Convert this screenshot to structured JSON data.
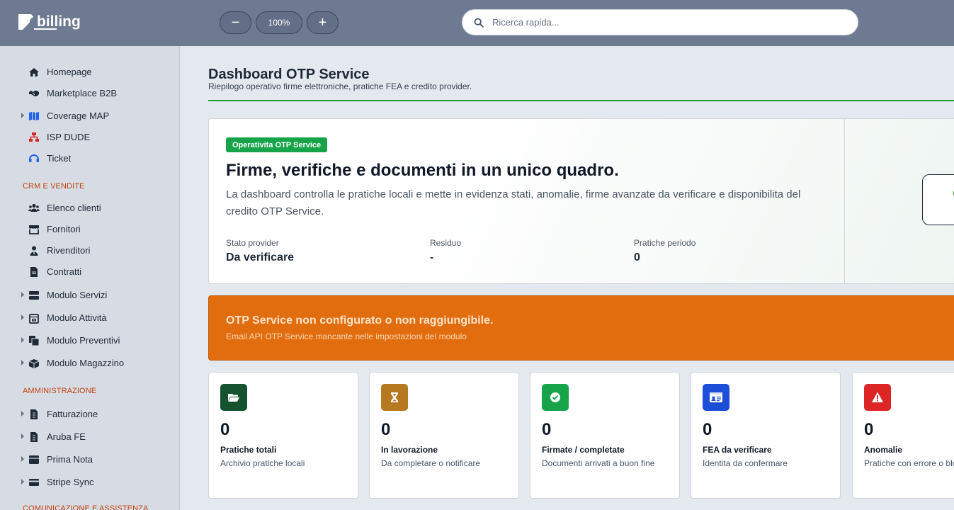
{
  "app": {
    "logo_text": "billing"
  },
  "toolbar": {
    "zoom_out_label": "−",
    "zoom_level": "100%",
    "zoom_in_label": "+"
  },
  "search": {
    "placeholder": "Ricerca rapida..."
  },
  "sidebar": {
    "items": [
      {
        "label": "Homepage",
        "icon": "home-icon"
      },
      {
        "label": "Marketplace B2B",
        "icon": "handshake-icon"
      },
      {
        "label": "Coverage MAP",
        "icon": "map-icon",
        "accent": "#2563eb"
      },
      {
        "label": "ISP DUDE",
        "icon": "network-icon",
        "accent": "#dc2626"
      },
      {
        "label": "Ticket",
        "icon": "headset-icon",
        "accent": "#2563eb"
      }
    ],
    "sections": [
      {
        "title": "CRM E VENDITE",
        "items": [
          {
            "label": "Elenco clienti",
            "icon": "users-icon"
          },
          {
            "label": "Fornitori",
            "icon": "store-icon"
          },
          {
            "label": "Rivenditori",
            "icon": "user-tie-icon"
          },
          {
            "label": "Contratti",
            "icon": "document-icon"
          },
          {
            "label": "Modulo Servizi",
            "icon": "server-icon"
          },
          {
            "label": "Modulo Attività",
            "icon": "calendar-icon"
          },
          {
            "label": "Modulo Preventivi",
            "icon": "file-copy-icon"
          },
          {
            "label": "Modulo Magazzino",
            "icon": "boxes-icon"
          }
        ]
      },
      {
        "title": "AMMINISTRAZIONE",
        "items": [
          {
            "label": "Fatturazione",
            "icon": "invoice-icon"
          },
          {
            "label": "Aruba FE",
            "icon": "invoice-icon"
          },
          {
            "label": "Prima Nota",
            "icon": "ledger-icon"
          },
          {
            "label": "Stripe Sync",
            "icon": "credit-card-icon"
          }
        ]
      },
      {
        "title": "COMUNICAZIONE E ASSISTENZA",
        "items": []
      }
    ]
  },
  "page": {
    "title": "Dashboard OTP Service",
    "subtitle": "Riepilogo operativo firme elettroniche, pratiche FEA e credito provider."
  },
  "hero": {
    "badge": "Operativita OTP Service",
    "heading": "Firme, verifiche e documenti in un unico quadro.",
    "text": "La dashboard controlla le pratiche locali e mette in evidenza stati, anomalie, firme avanzate da verificare e disponibilita del credito OTP Service.",
    "stats": [
      {
        "label": "Stato provider",
        "value": "Da verificare"
      },
      {
        "label": "Residuo",
        "value": "-"
      },
      {
        "label": "Pratiche periodo",
        "value": "0"
      }
    ]
  },
  "alert": {
    "title": "OTP Service non configurato o non raggiungibile.",
    "text": "Email API OTP Service mancante nelle impostazioni del modulo"
  },
  "cards": [
    {
      "value": "0",
      "title": "Pratiche totali",
      "desc": "Archivio pratiche locali",
      "icon": "folder-open-icon",
      "color": "#14532d"
    },
    {
      "value": "0",
      "title": "In lavorazione",
      "desc": "Da completare o notificare",
      "icon": "hourglass-icon",
      "color": "#b7791f"
    },
    {
      "value": "0",
      "title": "Firmate / completate",
      "desc": "Documenti arrivati a buon fine",
      "icon": "check-circle-icon",
      "color": "#16a34a"
    },
    {
      "value": "0",
      "title": "FEA da verificare",
      "desc": "Identita da confermare",
      "icon": "id-card-icon",
      "color": "#1d4ed8"
    },
    {
      "value": "0",
      "title": "Anomalie",
      "desc": "Pratiche con errore o blocco",
      "icon": "warning-icon",
      "color": "#dc2626"
    }
  ]
}
